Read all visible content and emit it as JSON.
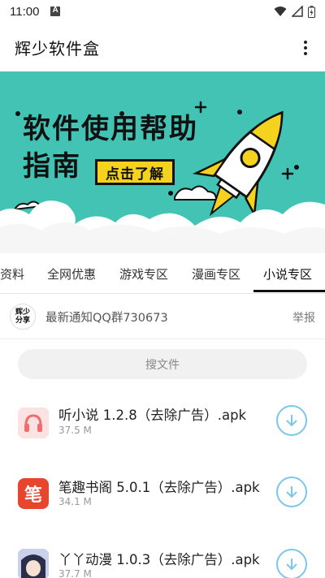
{
  "status_bar": {
    "time": "11:00"
  },
  "app_bar": {
    "title": "辉少软件盒"
  },
  "banner": {
    "line1": "软件使用帮助",
    "line2": "指南",
    "cta": "点击了解"
  },
  "tabs": {
    "items": [
      {
        "label": "资料"
      },
      {
        "label": "全网优惠"
      },
      {
        "label": "游戏专区"
      },
      {
        "label": "漫画专区"
      },
      {
        "label": "小说专区"
      }
    ],
    "active": "小说专区"
  },
  "notice": {
    "logo_line1": "辉少",
    "logo_line2": "分享",
    "text": "最新通知QQ群730673",
    "report": "举报"
  },
  "search": {
    "placeholder": "搜文件"
  },
  "files": [
    {
      "name": "听小说 1.2.8（去除广告）.apk",
      "size": "37.5 M",
      "icon": "headphones-icon",
      "icon_color": "#f26d6d"
    },
    {
      "name": "笔趣书阁 5.0.1（去除广告）.apk",
      "size": "34.1 M",
      "icon": "pen-char-icon",
      "icon_color": "#e8452f"
    },
    {
      "name": "丫丫动漫 1.0.3（去除广告）.apk",
      "size": "37.7 M",
      "icon": "anime-avatar-icon",
      "icon_color": "#3a4a7a"
    }
  ],
  "colors": {
    "banner_bg": "#43c3b3",
    "cta_bg": "#f5d21e",
    "download_ring": "#7cc6ea"
  },
  "icons": {
    "pen_char": "笔"
  }
}
